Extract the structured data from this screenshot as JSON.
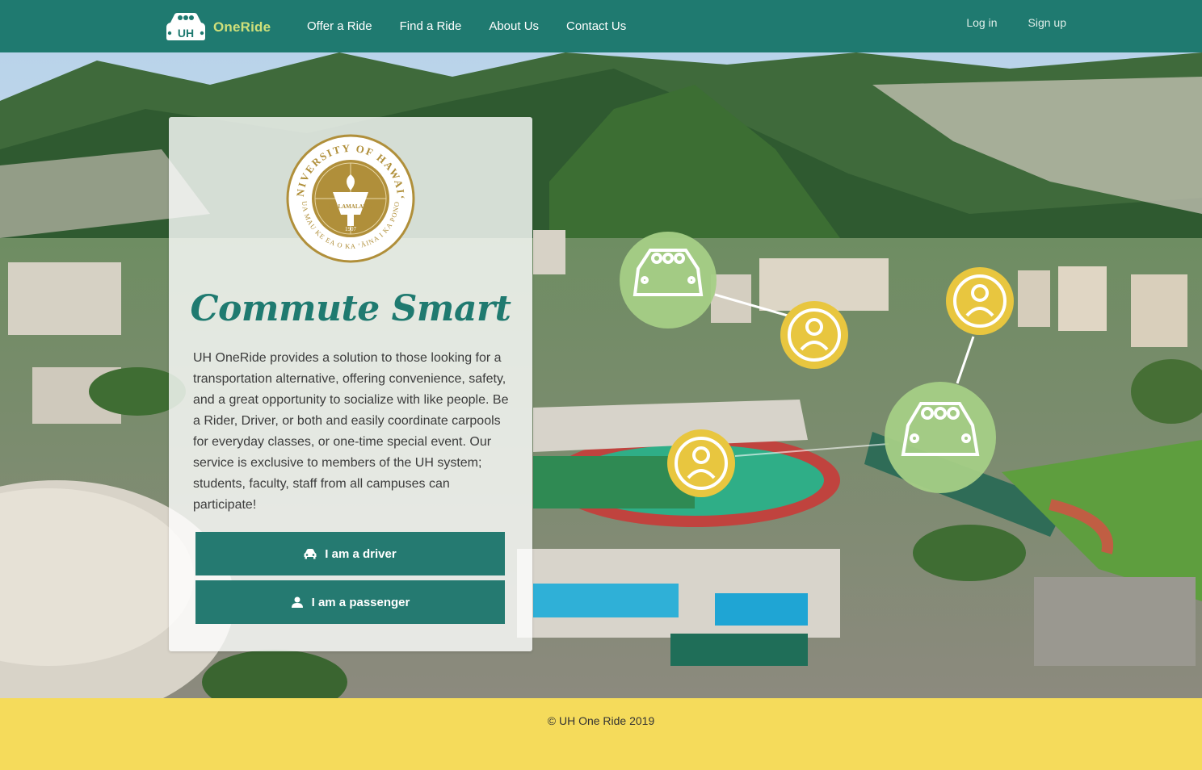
{
  "brand": {
    "logo_text": "UH",
    "name": "OneRide",
    "logo_icon": "car-logo-icon"
  },
  "nav": {
    "links": [
      "Offer a Ride",
      "Find a Ride",
      "About Us",
      "Contact Us"
    ],
    "auth": [
      "Log in",
      "Sign up"
    ]
  },
  "seal": {
    "top_text": "UNIVERSITY OF HAWAI‘I",
    "bottom_text": "UA MAU KE EA O KA ‘ĀINA I KA PONO",
    "motto": "MĀLAMALAMA",
    "year": "1907"
  },
  "hero": {
    "headline": "Commute Smart",
    "description": "UH OneRide provides a solution to those looking for a transportation alternative, offering convenience, safety, and a great opportunity to socialize with like people. Be a Rider, Driver, or both and easily coordinate carpools for everyday classes, or one-time special event. Our service is exclusive to members of the UH system; students, faculty, staff from all campuses can participate!"
  },
  "actions": {
    "driver_label": "I am a driver",
    "driver_icon": "car-icon",
    "passenger_label": "I am a passenger",
    "passenger_icon": "user-icon"
  },
  "footer": {
    "copyright": "© UH One Ride 2019"
  },
  "colors": {
    "primary": "#1f7a70",
    "button": "#257a71",
    "accent_yellow": "#f5db5b",
    "accent_green": "#a5cf86",
    "seal_gold": "#b08f3a"
  }
}
